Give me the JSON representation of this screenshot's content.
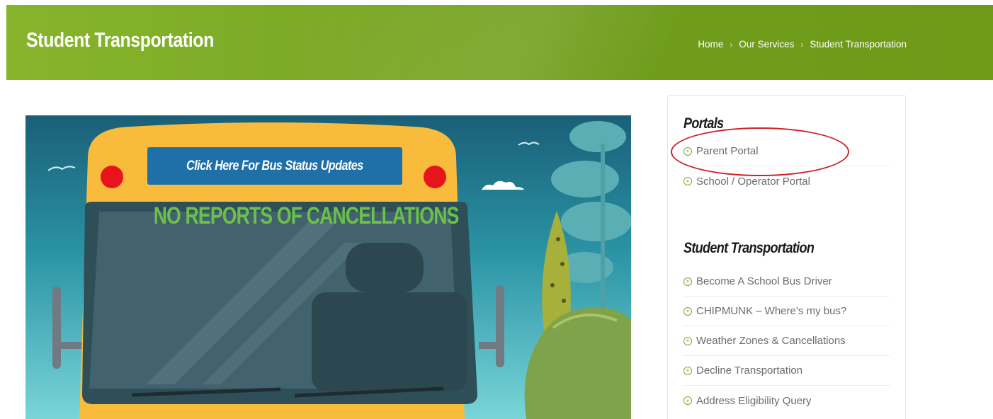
{
  "header": {
    "title": "Student Transportation",
    "breadcrumb": [
      "Home",
      "Our Services",
      "Student Transportation"
    ],
    "separator": "›"
  },
  "hero": {
    "button_label": "Click Here For Bus Status Updates",
    "status_text": "NO REPORTS OF CANCELLATIONS"
  },
  "sidebar": {
    "portals": {
      "heading": "Portals",
      "items": [
        "Parent Portal",
        "School / Operator Portal"
      ]
    },
    "transport": {
      "heading": "Student Transportation",
      "items": [
        "Become A School Bus Driver",
        "CHIPMUNK – Where’s my bus?",
        "Weather Zones & Cancellations",
        "Decline Transportation",
        "Address Eligibility Query"
      ]
    }
  },
  "colors": {
    "banner": "#7aa824",
    "accent": "#7aa82a",
    "bus_yellow": "#f9bb3c",
    "sky": "#1e6f86",
    "button_blue": "#1f6fa8",
    "status_green": "#6cc04a",
    "annotation_red": "#c8242a"
  }
}
